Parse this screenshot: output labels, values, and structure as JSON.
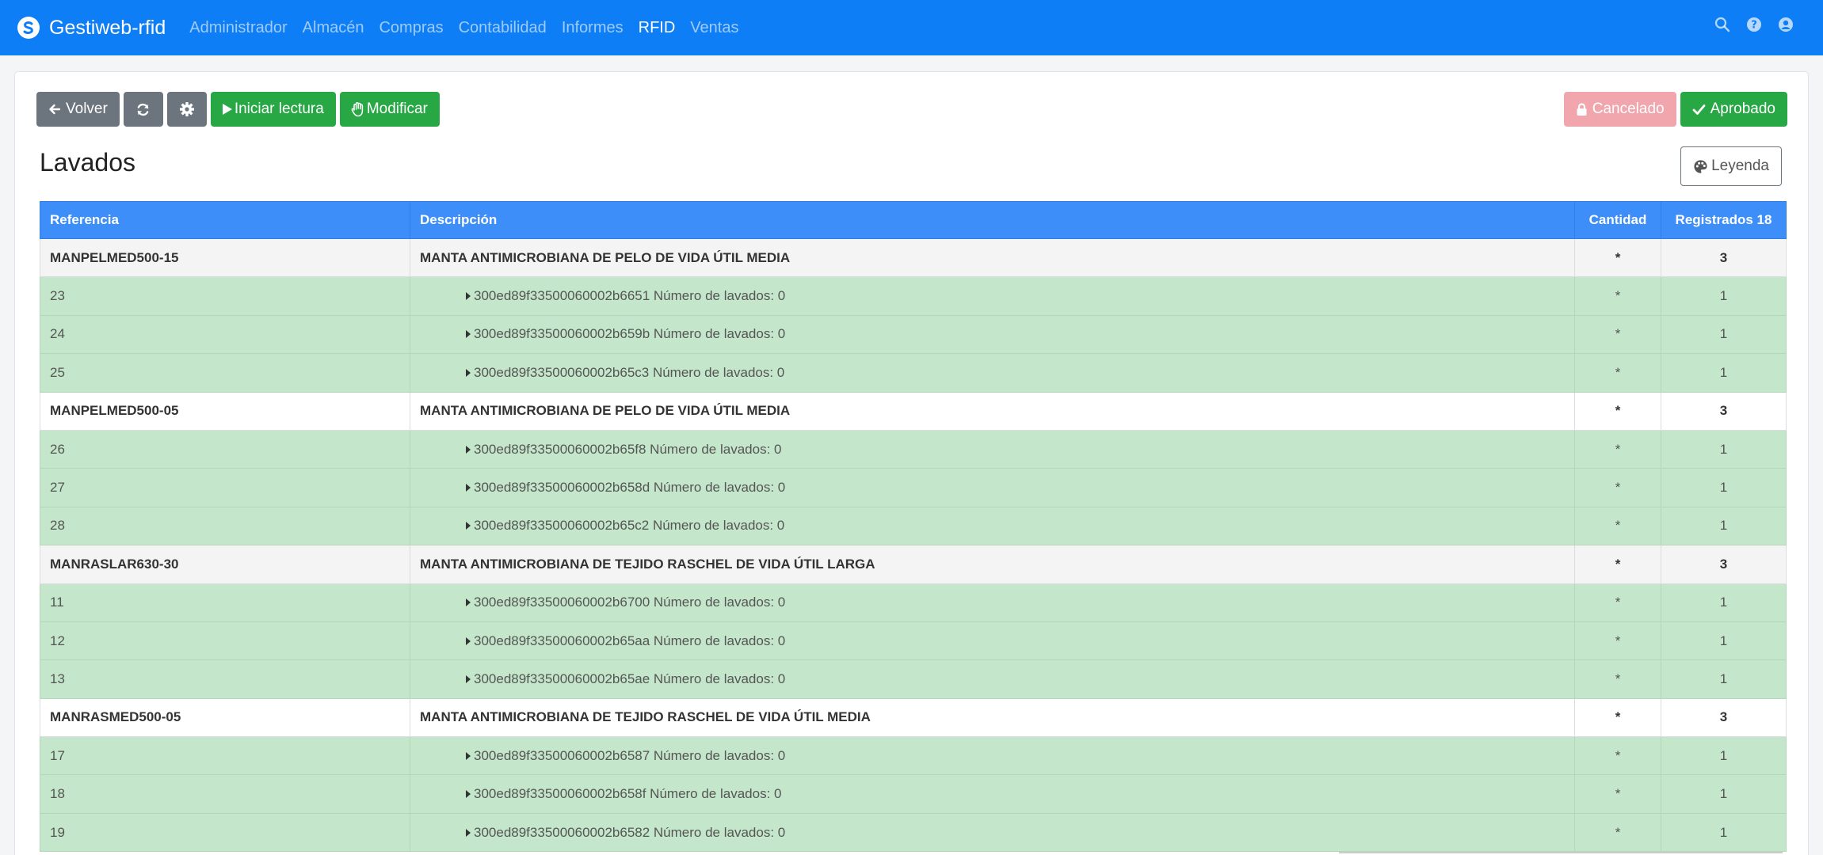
{
  "app": {
    "brand": "Gestiweb-rfid",
    "nav": [
      "Administrador",
      "Almacén",
      "Compras",
      "Contabilidad",
      "Informes",
      "RFID",
      "Ventas"
    ],
    "active_nav": "RFID"
  },
  "toolbar": {
    "back_label": "Volver",
    "read_label": "Iniciar lectura",
    "modify_label": "Modificar",
    "cancel_label": "Cancelado",
    "approve_label": "Aprobado"
  },
  "page": {
    "title": "Lavados",
    "legend_label": "Leyenda"
  },
  "table": {
    "headers": [
      "Referencia",
      "Descripción",
      "Cantidad",
      "Registrados 18"
    ],
    "groups": [
      {
        "ref": "MANPELMED500-15",
        "desc": "MANTA ANTIMICROBIANA DE PELO DE VIDA ÚTIL MEDIA",
        "qty": "*",
        "reg": "3",
        "items": [
          {
            "ref": "23",
            "desc": "300ed89f33500060002b6651 Número de lavados: 0",
            "qty": "*",
            "reg": "1"
          },
          {
            "ref": "24",
            "desc": "300ed89f33500060002b659b Número de lavados: 0",
            "qty": "*",
            "reg": "1"
          },
          {
            "ref": "25",
            "desc": "300ed89f33500060002b65c3 Número de lavados: 0",
            "qty": "*",
            "reg": "1"
          }
        ]
      },
      {
        "ref": "MANPELMED500-05",
        "desc": "MANTA ANTIMICROBIANA DE PELO DE VIDA ÚTIL MEDIA",
        "qty": "*",
        "reg": "3",
        "items": [
          {
            "ref": "26",
            "desc": "300ed89f33500060002b65f8 Número de lavados: 0",
            "qty": "*",
            "reg": "1"
          },
          {
            "ref": "27",
            "desc": "300ed89f33500060002b658d Número de lavados: 0",
            "qty": "*",
            "reg": "1"
          },
          {
            "ref": "28",
            "desc": "300ed89f33500060002b65c2 Número de lavados: 0",
            "qty": "*",
            "reg": "1"
          }
        ]
      },
      {
        "ref": "MANRASLAR630-30",
        "desc": "MANTA ANTIMICROBIANA DE TEJIDO RASCHEL DE VIDA ÚTIL LARGA",
        "qty": "*",
        "reg": "3",
        "items": [
          {
            "ref": "11",
            "desc": "300ed89f33500060002b6700 Número de lavados: 0",
            "qty": "*",
            "reg": "1"
          },
          {
            "ref": "12",
            "desc": "300ed89f33500060002b65aa Número de lavados: 0",
            "qty": "*",
            "reg": "1"
          },
          {
            "ref": "13",
            "desc": "300ed89f33500060002b65ae Número de lavados: 0",
            "qty": "*",
            "reg": "1"
          }
        ]
      },
      {
        "ref": "MANRASMED500-05",
        "desc": "MANTA ANTIMICROBIANA DE TEJIDO RASCHEL DE VIDA ÚTIL MEDIA",
        "qty": "*",
        "reg": "3",
        "items": [
          {
            "ref": "17",
            "desc": "300ed89f33500060002b6587 Número de lavados: 0",
            "qty": "*",
            "reg": "1"
          },
          {
            "ref": "18",
            "desc": "300ed89f33500060002b658f Número de lavados: 0",
            "qty": "*",
            "reg": "1"
          },
          {
            "ref": "19",
            "desc": "300ed89f33500060002b6582 Número de lavados: 0",
            "qty": "*",
            "reg": "1"
          }
        ]
      }
    ]
  },
  "colors": {
    "navbar": "#0d7ef5",
    "table_header": "#3d8ef8",
    "item_row": "#c4e6ca",
    "success": "#28a745",
    "cancel": "#f1a6ad",
    "secondary": "#6c757d"
  },
  "icons": {
    "brand": "brand-logo-icon",
    "search": "search-icon",
    "help": "help-circle-icon",
    "user": "user-circle-icon",
    "back": "arrow-left-icon",
    "refresh": "refresh-icon",
    "settings": "gear-icon",
    "play": "play-icon",
    "hand": "hand-icon",
    "lock": "lock-icon",
    "check": "check-icon",
    "palette": "palette-icon",
    "caret": "caret-right-icon"
  }
}
